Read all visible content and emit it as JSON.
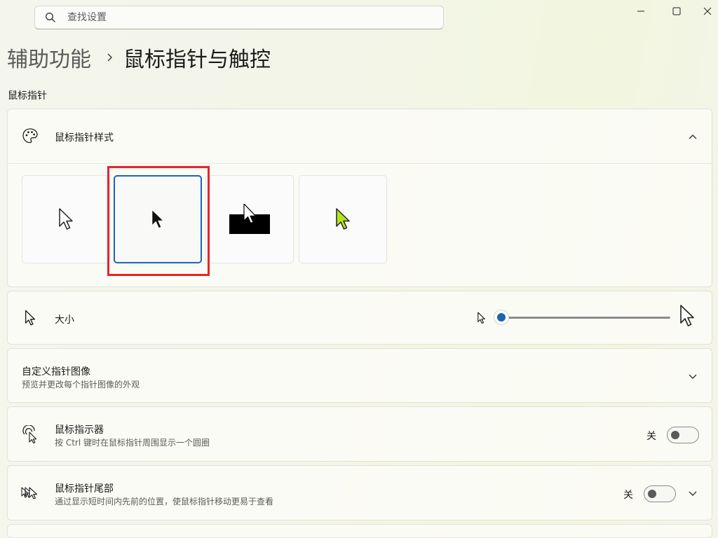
{
  "search": {
    "placeholder": "查找设置"
  },
  "window": {
    "minimize_icon": "minimize-icon",
    "maximize_icon": "maximize-icon",
    "close_icon": "close-icon"
  },
  "breadcrumb": {
    "parent": "辅助功能",
    "current": "鼠标指针与触控"
  },
  "section": {
    "title": "鼠标指针"
  },
  "style_card": {
    "title": "鼠标指针样式",
    "icon": "palette-icon",
    "expanded": true,
    "options": [
      {
        "name": "white",
        "selected": false
      },
      {
        "name": "black",
        "selected": true
      },
      {
        "name": "inverted",
        "selected": false
      },
      {
        "name": "custom",
        "selected": false,
        "color": "#b4e61e"
      }
    ]
  },
  "size_card": {
    "title": "大小",
    "icon": "cursor-icon",
    "slider_value": 1,
    "slider_min": 1,
    "slider_max": 15
  },
  "custom_card": {
    "title": "自定义指针图像",
    "subtitle": "预览并更改每个指针图像的外观"
  },
  "indicator_card": {
    "title": "鼠标指示器",
    "subtitle": "按 Ctrl 键时在鼠标指针周围显示一个圆圈",
    "toggle_label": "关",
    "on": false
  },
  "trail_card": {
    "title": "鼠标指针尾部",
    "subtitle": "通过显示短时间内先前的位置，使鼠标指针移动更易于查看",
    "toggle_label": "关",
    "on": false
  },
  "colors": {
    "accent": "#1a66b4",
    "highlight": "#e9232a",
    "custom_cursor": "#b4e61e"
  }
}
